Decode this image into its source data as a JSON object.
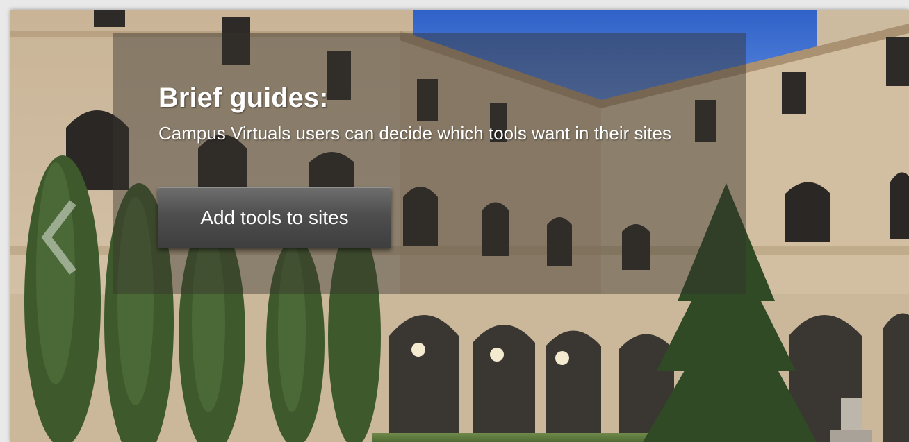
{
  "slider": {
    "slide": {
      "title": "Brief guides:",
      "description": "Campus Virtuals users can decide which tools want in their sites",
      "button_label": "Add tools to sites"
    },
    "prev_icon": "chevron-left-icon"
  },
  "colors": {
    "overlay": "#37322d",
    "button": "#4e4e4e",
    "text": "#ffffff",
    "sky": "#3c6fd0",
    "stone": "#cdbba0"
  }
}
